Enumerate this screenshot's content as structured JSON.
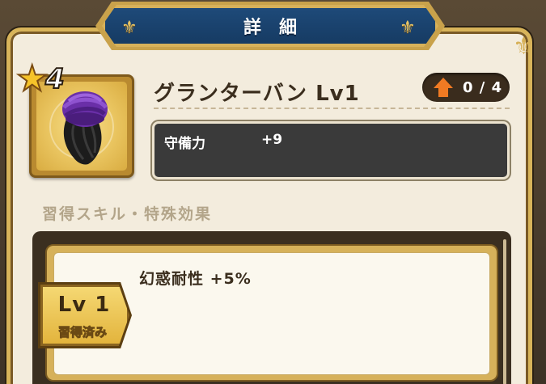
{
  "header": {
    "title": "詳細",
    "left_ornament_icon": "fleur-de-lis-icon",
    "right_ornament_icon": "fleur-de-lis-icon"
  },
  "item": {
    "name": "グランターバン Lv1",
    "rarity": "4",
    "icon": "purple-turban-icon",
    "upgrade_count": "0 / 4",
    "upgrade_icon": "up-arrow-icon"
  },
  "stats": [
    {
      "label": "守備力",
      "value": "+9"
    }
  ],
  "skills": {
    "section_title": "習得スキル・特殊効果",
    "entries": [
      {
        "level": "Lv 1",
        "status": "習得済み",
        "effect": "幻惑耐性 +5%"
      }
    ]
  },
  "colors": {
    "banner_blue": "#1e4a79",
    "gold": "#d8b45a",
    "panel_cream": "#f3ecdd",
    "upgrade_orange": "#f07a23"
  }
}
